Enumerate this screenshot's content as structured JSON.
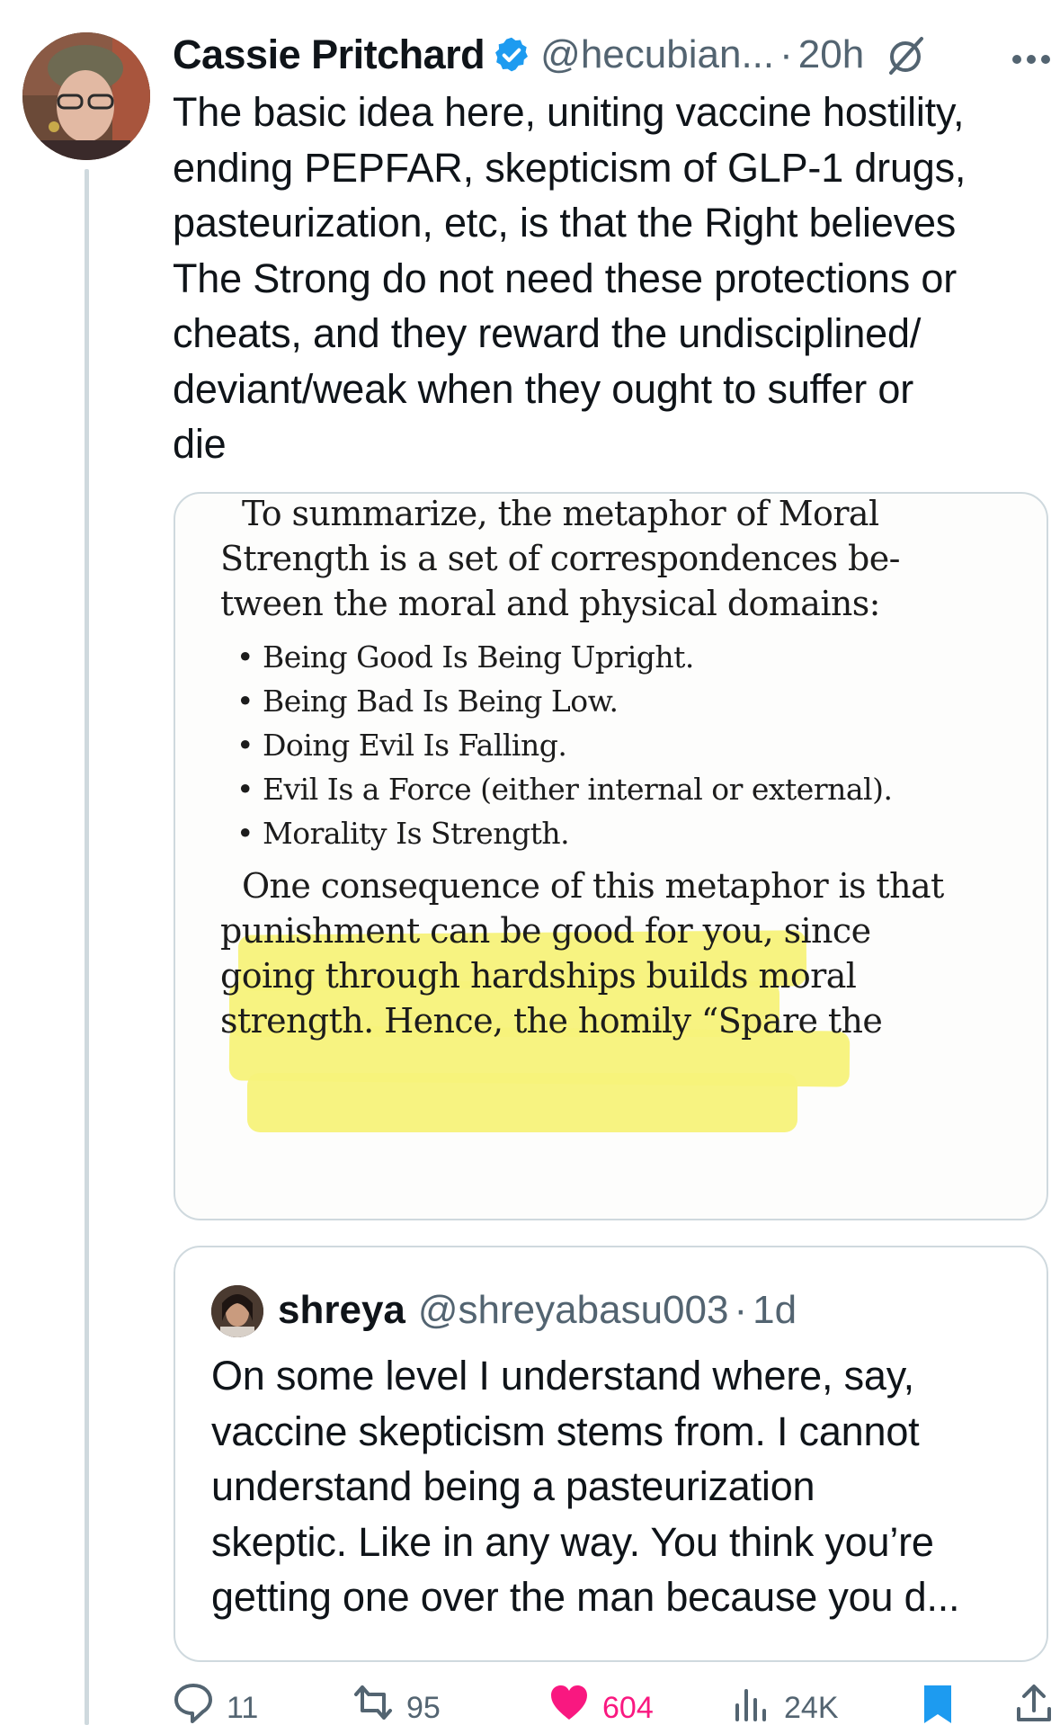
{
  "tweet": {
    "author_name": "Cassie Pritchard",
    "handle": "@hecubian...",
    "separator": "·",
    "time": "20h",
    "text_lines": [
      "The basic idea here, uniting vaccine hostility,",
      "ending PEPFAR, skepticism of GLP-1 drugs,",
      "pasteurization, etc, is that the Right believes",
      "The Strong do not need these protections or",
      "cheats, and they reward the undisciplined/",
      "deviant/weak when they ought to suffer or",
      "die"
    ]
  },
  "image": {
    "para1": [
      "To summarize, the metaphor of Moral",
      "Strength is a set of correspondences be-",
      "tween the moral and physical domains:"
    ],
    "bullets": [
      "• Being Good Is Being Upright.",
      "• Being Bad Is Being Low.",
      "• Doing Evil Is Falling.",
      "• Evil Is a Force (either internal or external).",
      "• Morality Is Strength."
    ],
    "para2": [
      "One consequence of this metaphor is that",
      "punishment can be good for you, since",
      "going through hardships builds moral",
      "strength. Hence, the homily “Spare the"
    ]
  },
  "quote": {
    "name": "shreya",
    "handle": "@shreyabasu003",
    "separator": "·",
    "time": "1d",
    "text_lines": [
      "On some level I understand where, say,",
      "vaccine skepticism stems from. I cannot",
      "understand being a pasteurization",
      "skeptic. Like in any way. You think you’re",
      "getting one over the man because you d..."
    ]
  },
  "actions": {
    "replies": "11",
    "reposts": "95",
    "likes": "604",
    "views": "24K"
  },
  "colors": {
    "verified": "#1d9bf0",
    "like": "#f91880",
    "secondary_text": "#536471",
    "highlight": "#f7f27a",
    "bookmark_active": "#1d9bf0"
  },
  "icons": [
    "verified-badge-icon",
    "mute-icon",
    "more-icon",
    "reply-icon",
    "repost-icon",
    "like-icon",
    "views-icon",
    "bookmark-icon",
    "share-icon"
  ]
}
